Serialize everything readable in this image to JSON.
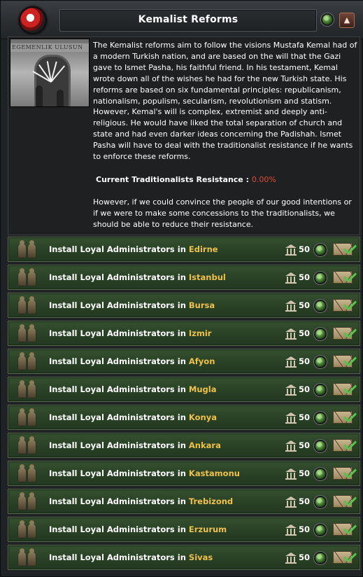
{
  "window": {
    "title": "Kemalist Reforms",
    "collapse_icon": "chevron-up-icon",
    "emblem_icon": "nation-emblem-icon"
  },
  "picture": {
    "inscription": "EGEMENLIK ULUSUN"
  },
  "description": {
    "paragraph": "The Kemalist reforms aim to follow the visions Mustafa Kemal had of a modern Turkish nation, and are based on the will that the Gazi gave to Ismet Pasha, his faithful friend. In his testament, Kemal wrote down all of the wishes he had for the new Turkish state. His reforms are based on six fundamental principles: republicanism, nationalism, populism, secularism, revolutionism and statism. However, Kemal's will is complex, extremist and deeply anti-religious. He would have liked the total separation of church and state and had even darker ideas concerning the Padishah. Ismet Pasha will have to deal with the traditionalist resistance if he wants to enforce these reforms.",
    "resistance_label": "Current Traditionalists Resistance : ",
    "resistance_value": "0.00%",
    "closing": "However, if we could convince the people of our good intentions or if we were to make some concessions to the traditionalists, we should be able to reduce their resistance."
  },
  "decisions": {
    "label_prefix": "Install Loyal Administrators in ",
    "items": [
      {
        "city": "Edirne",
        "cost": "50"
      },
      {
        "city": "Istanbul",
        "cost": "50"
      },
      {
        "city": "Bursa",
        "cost": "50"
      },
      {
        "city": "Izmir",
        "cost": "50"
      },
      {
        "city": "Afyon",
        "cost": "50"
      },
      {
        "city": "Mugla",
        "cost": "50"
      },
      {
        "city": "Konya",
        "cost": "50"
      },
      {
        "city": "Ankara",
        "cost": "50"
      },
      {
        "city": "Kastamonu",
        "cost": "50"
      },
      {
        "city": "Trebizond",
        "cost": "50"
      },
      {
        "city": "Erzurum",
        "cost": "50"
      },
      {
        "city": "Sivas",
        "cost": "50"
      }
    ]
  },
  "colors": {
    "city_highlight": "#f0c14a",
    "resistance_value": "#e04a3a",
    "row_green": "#2a4226"
  }
}
